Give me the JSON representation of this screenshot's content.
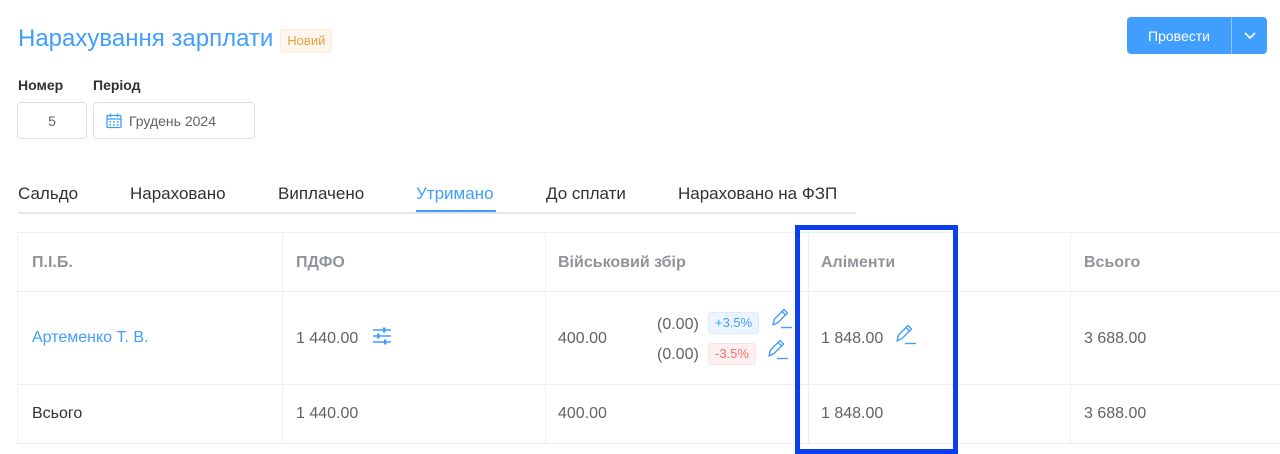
{
  "header": {
    "title": "Нарахування зарплати",
    "status_badge": "Новий",
    "post_button": "Провести"
  },
  "fields": {
    "number_label": "Номер",
    "number_value": "5",
    "period_label": "Період",
    "period_value": "Грудень 2024"
  },
  "tabs": [
    {
      "label": "Сальдо"
    },
    {
      "label": "Нараховано"
    },
    {
      "label": "Виплачено"
    },
    {
      "label": "Утримано",
      "active": true
    },
    {
      "label": "До сплати"
    },
    {
      "label": "Нараховано на ФЗП"
    }
  ],
  "table": {
    "headers": [
      "П.І.Б.",
      "ПДФО",
      "Військовий збір",
      "Аліменти",
      "Всього"
    ],
    "row": {
      "name": "Артеменко Т. В.",
      "pdfo": "1 440.00",
      "military": "400.00",
      "military_adj_1": "(0.00)",
      "military_adj_1_badge": "+3.5%",
      "military_adj_2": "(0.00)",
      "military_adj_2_badge": "-3.5%",
      "alimony": "1 848.00",
      "total": "3 688.00"
    },
    "totals": {
      "label": "Всього",
      "pdfo": "1 440.00",
      "military": "400.00",
      "alimony": "1 848.00",
      "total": "3 688.00"
    }
  },
  "colors": {
    "accent": "#409eff",
    "badge_warning": "#e6a23c",
    "negative": "#f56c6c",
    "highlight_frame": "#0a3ef0"
  },
  "icons": {
    "post_dropdown": "chevron-down-icon",
    "period": "calendar-icon",
    "pdfo": "sliders-icon",
    "edit": "pencil-icon"
  }
}
